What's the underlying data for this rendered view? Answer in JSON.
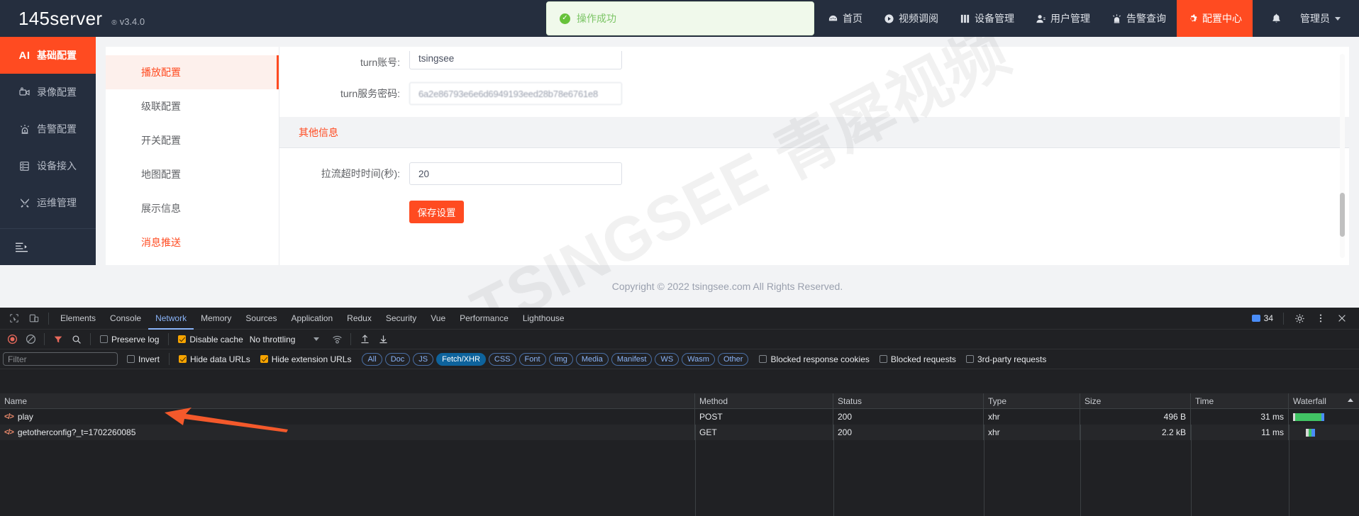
{
  "header": {
    "brand_name": "145server",
    "brand_reg": "®",
    "version": "v3.4.0",
    "toast": {
      "text": "操作成功",
      "icon": "check-circle-icon",
      "color": "#67c23a"
    },
    "nav": [
      {
        "label": "首页",
        "icon": "dashboard-icon",
        "active": false
      },
      {
        "label": "视频调阅",
        "icon": "play-circle-icon",
        "active": false
      },
      {
        "label": "设备管理",
        "icon": "device-icon",
        "active": false
      },
      {
        "label": "用户管理",
        "icon": "user-icon",
        "active": false
      },
      {
        "label": "告警查询",
        "icon": "alarm-icon",
        "active": false
      },
      {
        "label": "配置中心",
        "icon": "gear-icon",
        "active": true
      }
    ],
    "bell_icon": "bell-icon",
    "user": "管理员",
    "accent": "#ff4b21"
  },
  "sidebar": {
    "items": [
      {
        "label": "基础配置",
        "icon": "ai-icon",
        "active": true
      },
      {
        "label": "录像配置",
        "icon": "video-record-icon",
        "active": false
      },
      {
        "label": "告警配置",
        "icon": "alarm-icon",
        "active": false
      },
      {
        "label": "设备接入",
        "icon": "server-icon",
        "active": false
      },
      {
        "label": "运维管理",
        "icon": "wrench-icon",
        "active": false
      }
    ],
    "collapse_icon": "collapse-menu-icon"
  },
  "submenu": {
    "items": [
      {
        "label": "播放配置",
        "active": true,
        "highlight": false
      },
      {
        "label": "级联配置",
        "active": false,
        "highlight": false
      },
      {
        "label": "开关配置",
        "active": false,
        "highlight": false
      },
      {
        "label": "地图配置",
        "active": false,
        "highlight": false
      },
      {
        "label": "展示信息",
        "active": false,
        "highlight": false
      },
      {
        "label": "消息推送",
        "active": false,
        "highlight": true
      }
    ]
  },
  "form": {
    "fields": [
      {
        "label": "turn账号:",
        "value": "tsingsee",
        "blurred": false
      },
      {
        "label": "turn服务密码:",
        "value": "6a2e86793e6e6d6949193eed28b78e6761e8",
        "blurred": true
      }
    ],
    "section_title": "其他信息",
    "timeout_label": "拉流超时时间(秒):",
    "timeout_value": "20",
    "save_label": "保存设置"
  },
  "watermark": {
    "text": "TSINGSEE 青犀视频"
  },
  "footer": {
    "copyright": "Copyright © 2022 tsingsee.com All Rights Reserved."
  },
  "devtools": {
    "tabs": [
      {
        "label": "Elements",
        "active": false
      },
      {
        "label": "Console",
        "active": false
      },
      {
        "label": "Network",
        "active": true
      },
      {
        "label": "Memory",
        "active": false
      },
      {
        "label": "Sources",
        "active": false
      },
      {
        "label": "Application",
        "active": false
      },
      {
        "label": "Redux",
        "active": false
      },
      {
        "label": "Security",
        "active": false
      },
      {
        "label": "Vue",
        "active": false
      },
      {
        "label": "Performance",
        "active": false
      },
      {
        "label": "Lighthouse",
        "active": false
      }
    ],
    "message_count": "34",
    "toolbar": {
      "record_icon": "record-stop-icon",
      "clear_icon": "clear-icon",
      "filter_icon": "filter-icon",
      "search_icon": "search-icon",
      "preserve_log": {
        "label": "Preserve log",
        "checked": false
      },
      "disable_cache": {
        "label": "Disable cache",
        "checked": true
      },
      "throttling": "No throttling",
      "import_icon": "import-har-icon",
      "export_icon": "export-har-icon",
      "wifi_icon": "network-conditions-icon"
    },
    "filterbar": {
      "filter_placeholder": "Filter",
      "invert": {
        "label": "Invert",
        "checked": false
      },
      "hide_data_urls": {
        "label": "Hide data URLs",
        "checked": true
      },
      "hide_ext_urls": {
        "label": "Hide extension URLs",
        "checked": true
      },
      "types": [
        {
          "label": "All",
          "active": false
        },
        {
          "label": "Doc",
          "active": false
        },
        {
          "label": "JS",
          "active": false
        },
        {
          "label": "Fetch/XHR",
          "active": true
        },
        {
          "label": "CSS",
          "active": false
        },
        {
          "label": "Font",
          "active": false
        },
        {
          "label": "Img",
          "active": false
        },
        {
          "label": "Media",
          "active": false
        },
        {
          "label": "Manifest",
          "active": false
        },
        {
          "label": "WS",
          "active": false
        },
        {
          "label": "Wasm",
          "active": false
        },
        {
          "label": "Other",
          "active": false
        }
      ],
      "blocked_response_cookies": {
        "label": "Blocked response cookies",
        "checked": false
      },
      "blocked_requests": {
        "label": "Blocked requests",
        "checked": false
      },
      "third_party": {
        "label": "3rd-party requests",
        "checked": false
      }
    },
    "table": {
      "columns": [
        "Name",
        "Method",
        "Status",
        "Type",
        "Size",
        "Time",
        "Waterfall"
      ],
      "rows": [
        {
          "name": "play",
          "method": "POST",
          "status": "200",
          "type": "xhr",
          "size": "496 B",
          "time": "31 ms"
        },
        {
          "name": "getotherconfig?_t=1702260085",
          "method": "GET",
          "status": "200",
          "type": "xhr",
          "size": "2.2 kB",
          "time": "11 ms"
        }
      ]
    }
  },
  "annotation": {
    "arrow_color": "#f4592b"
  }
}
